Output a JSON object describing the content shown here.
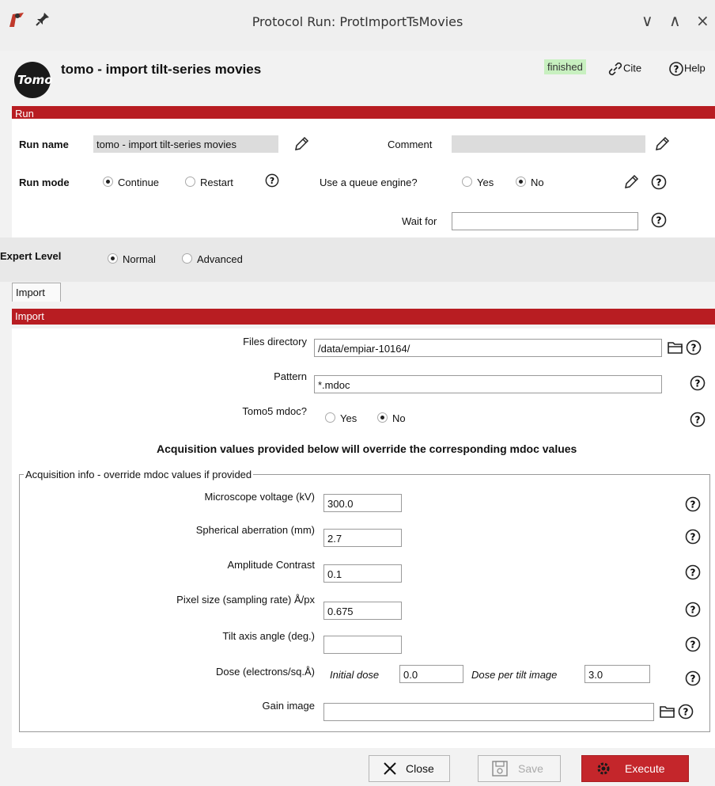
{
  "window": {
    "title": "Protocol Run: ProtImportTsMovies",
    "controls": [
      "∨",
      "∧",
      "×"
    ]
  },
  "header": {
    "logo_text": "Tomo",
    "protocol_title": "tomo - import tilt-series movies",
    "status": "finished",
    "cite_label": "Cite",
    "help_label": "Help"
  },
  "run_section": {
    "title": "Run",
    "run_name_label": "Run name",
    "run_name_value": "tomo - import tilt-series movies",
    "comment_label": "Comment",
    "comment_value": "",
    "run_mode_label": "Run mode",
    "run_mode_options": [
      "Continue",
      "Restart"
    ],
    "run_mode_selected": "Continue",
    "queue_label": "Use a queue engine?",
    "queue_options": [
      "Yes",
      "No"
    ],
    "queue_selected": "No",
    "wait_for_label": "Wait for",
    "wait_for_value": ""
  },
  "expert": {
    "label": "Expert Level",
    "options": [
      "Normal",
      "Advanced"
    ],
    "selected": "Normal"
  },
  "tabs": [
    "Import"
  ],
  "import_section": {
    "title": "Import",
    "files_directory_label": "Files directory",
    "files_directory_value": "/data/empiar-10164/",
    "pattern_label": "Pattern",
    "pattern_value": "*.mdoc",
    "tomo5_label": "Tomo5 mdoc?",
    "tomo5_options": [
      "Yes",
      "No"
    ],
    "tomo5_selected": "No",
    "override_note": "Acquisition values provided below will override the corresponding mdoc values"
  },
  "acquisition": {
    "group_title": "Acquisition info - override mdoc values if provided",
    "voltage_label": "Microscope voltage (kV)",
    "voltage_value": "300.0",
    "cs_label": "Spherical aberration (mm)",
    "cs_value": "2.7",
    "amp_label": "Amplitude Contrast",
    "amp_value": "0.1",
    "pixel_label": "Pixel size (sampling rate) Å/px",
    "pixel_value": "0.675",
    "tilt_label": "Tilt axis angle (deg.)",
    "tilt_value": "",
    "dose_label": "Dose (electrons/sq.Å)",
    "initial_dose_label": "Initial dose",
    "initial_dose_value": "0.0",
    "dose_per_tilt_label": "Dose per tilt image",
    "dose_per_tilt_value": "3.0",
    "gain_label": "Gain image",
    "gain_value": ""
  },
  "footer": {
    "close_label": "Close",
    "save_label": "Save",
    "execute_label": "Execute"
  },
  "colors": {
    "section_red": "#b81d22",
    "status_green": "#c8f0c0",
    "execute_red": "#c4262b"
  }
}
